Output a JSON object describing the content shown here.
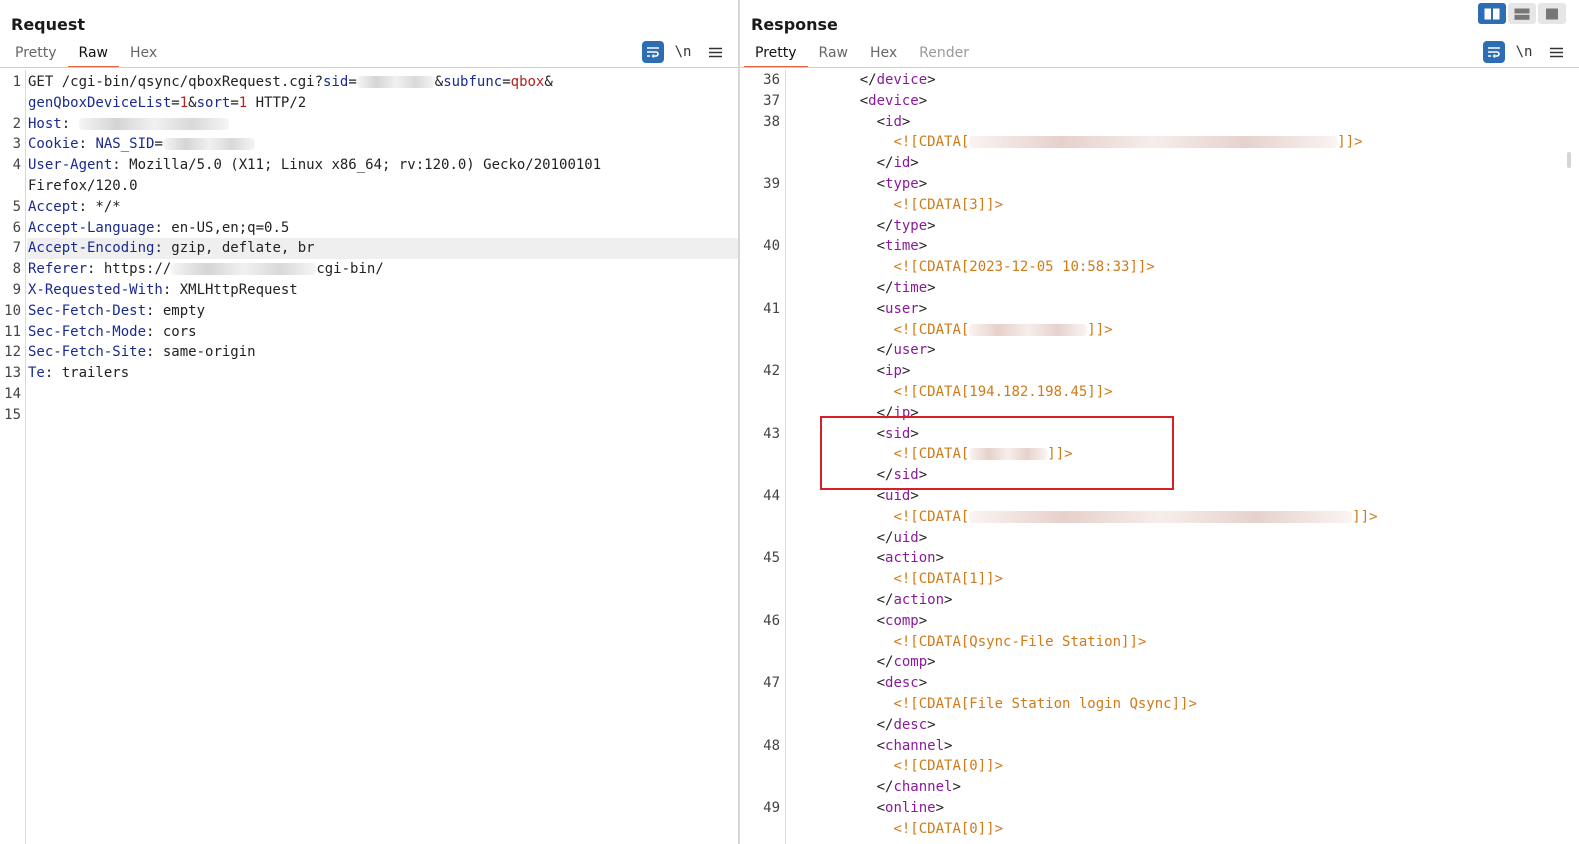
{
  "request": {
    "title": "Request",
    "tabs": [
      {
        "label": "Pretty"
      },
      {
        "label": "Raw"
      },
      {
        "label": "Hex"
      }
    ],
    "active_tab": "Raw",
    "tools": {
      "wrap_icon": "wrap-lines-icon",
      "newline_label": "\\n",
      "menu_icon": "menu-icon"
    },
    "lines": [
      {
        "n": "1",
        "segs": [
          [
            "t",
            "GET /cgi-bin/qsync/qboxRequest.cgi?"
          ],
          [
            "k",
            "sid"
          ],
          [
            "t",
            "="
          ],
          [
            "b",
            ""
          ],
          [
            "t",
            "&"
          ],
          [
            "k",
            "subfunc"
          ],
          [
            "t",
            "="
          ],
          [
            "v",
            "qbox"
          ],
          [
            "t",
            "&"
          ]
        ]
      },
      {
        "n": "",
        "segs": [
          [
            "k",
            "genQboxDeviceList"
          ],
          [
            "t",
            "="
          ],
          [
            "v",
            "1"
          ],
          [
            "t",
            "&"
          ],
          [
            "k",
            "sort"
          ],
          [
            "t",
            "="
          ],
          [
            "v",
            "1"
          ],
          [
            "t",
            " HTTP/2"
          ]
        ]
      },
      {
        "n": "2",
        "segs": [
          [
            "k",
            "Host"
          ],
          [
            "t",
            ": "
          ],
          [
            "b",
            ""
          ]
        ]
      },
      {
        "n": "3",
        "segs": [
          [
            "k",
            "Cookie"
          ],
          [
            "t",
            ": "
          ],
          [
            "k",
            "NAS_SID"
          ],
          [
            "t",
            "="
          ],
          [
            "b",
            ""
          ]
        ]
      },
      {
        "n": "4",
        "segs": [
          [
            "k",
            "User-Agent"
          ],
          [
            "t",
            ": Mozilla/5.0 (X11; Linux x86_64; rv:120.0) Gecko/20100101"
          ]
        ]
      },
      {
        "n": "",
        "segs": [
          [
            "t",
            "Firefox/120.0"
          ]
        ]
      },
      {
        "n": "5",
        "segs": [
          [
            "k",
            "Accept"
          ],
          [
            "t",
            ": */*"
          ]
        ]
      },
      {
        "n": "6",
        "segs": [
          [
            "k",
            "Accept-Language"
          ],
          [
            "t",
            ": en-US,en;q=0.5"
          ]
        ]
      },
      {
        "n": "7",
        "hl": true,
        "segs": [
          [
            "k",
            "Accept-Encoding"
          ],
          [
            "t",
            ": gzip, deflate, br"
          ]
        ]
      },
      {
        "n": "8",
        "segs": [
          [
            "k",
            "Referer"
          ],
          [
            "t",
            ": https://"
          ],
          [
            "b",
            ""
          ],
          [
            "t",
            "cgi-bin/"
          ]
        ]
      },
      {
        "n": "9",
        "segs": [
          [
            "k",
            "X-Requested-With"
          ],
          [
            "t",
            ": XMLHttpRequest"
          ]
        ]
      },
      {
        "n": "10",
        "segs": [
          [
            "k",
            "Sec-Fetch-Dest"
          ],
          [
            "t",
            ": empty"
          ]
        ]
      },
      {
        "n": "11",
        "segs": [
          [
            "k",
            "Sec-Fetch-Mode"
          ],
          [
            "t",
            ": cors"
          ]
        ]
      },
      {
        "n": "12",
        "segs": [
          [
            "k",
            "Sec-Fetch-Site"
          ],
          [
            "t",
            ": same-origin"
          ]
        ]
      },
      {
        "n": "13",
        "segs": [
          [
            "k",
            "Te"
          ],
          [
            "t",
            ": trailers"
          ]
        ]
      },
      {
        "n": "14",
        "segs": []
      },
      {
        "n": "15",
        "segs": []
      }
    ]
  },
  "response": {
    "title": "Response",
    "tabs": [
      {
        "label": "Pretty"
      },
      {
        "label": "Raw"
      },
      {
        "label": "Hex"
      },
      {
        "label": "Render"
      }
    ],
    "active_tab": "Pretty",
    "tools": {
      "wrap_icon": "wrap-lines-icon",
      "newline_label": "\\n",
      "menu_icon": "menu-icon"
    },
    "lines": [
      {
        "n": "36",
        "i": 4,
        "segs": [
          [
            "t",
            "</"
          ],
          [
            "g",
            "device"
          ],
          [
            "t",
            ">"
          ]
        ]
      },
      {
        "n": "37",
        "i": 4,
        "segs": [
          [
            "t",
            "<"
          ],
          [
            "g",
            "device"
          ],
          [
            "t",
            ">"
          ]
        ]
      },
      {
        "n": "38",
        "i": 6,
        "segs": [
          [
            "t",
            "<"
          ],
          [
            "g",
            "id"
          ],
          [
            "t",
            ">"
          ]
        ]
      },
      {
        "n": "",
        "i": 8,
        "segs": [
          [
            "c",
            "<![CDATA["
          ],
          [
            "b",
            ""
          ],
          [
            "c",
            "]]>"
          ]
        ]
      },
      {
        "n": "",
        "i": 6,
        "segs": [
          [
            "t",
            "</"
          ],
          [
            "g",
            "id"
          ],
          [
            "t",
            ">"
          ]
        ]
      },
      {
        "n": "39",
        "i": 6,
        "segs": [
          [
            "t",
            "<"
          ],
          [
            "g",
            "type"
          ],
          [
            "t",
            ">"
          ]
        ]
      },
      {
        "n": "",
        "i": 8,
        "segs": [
          [
            "c",
            "<![CDATA[3]]>"
          ]
        ]
      },
      {
        "n": "",
        "i": 6,
        "segs": [
          [
            "t",
            "</"
          ],
          [
            "g",
            "type"
          ],
          [
            "t",
            ">"
          ]
        ]
      },
      {
        "n": "40",
        "i": 6,
        "segs": [
          [
            "t",
            "<"
          ],
          [
            "g",
            "time"
          ],
          [
            "t",
            ">"
          ]
        ]
      },
      {
        "n": "",
        "i": 8,
        "segs": [
          [
            "c",
            "<![CDATA[2023-12-05 10:58:33]]>"
          ]
        ]
      },
      {
        "n": "",
        "i": 6,
        "segs": [
          [
            "t",
            "</"
          ],
          [
            "g",
            "time"
          ],
          [
            "t",
            ">"
          ]
        ]
      },
      {
        "n": "41",
        "i": 6,
        "segs": [
          [
            "t",
            "<"
          ],
          [
            "g",
            "user"
          ],
          [
            "t",
            ">"
          ]
        ]
      },
      {
        "n": "",
        "i": 8,
        "segs": [
          [
            "c",
            "<![CDATA["
          ],
          [
            "b",
            ""
          ],
          [
            "c",
            "]]>"
          ]
        ]
      },
      {
        "n": "",
        "i": 6,
        "segs": [
          [
            "t",
            "</"
          ],
          [
            "g",
            "user"
          ],
          [
            "t",
            ">"
          ]
        ]
      },
      {
        "n": "42",
        "i": 6,
        "segs": [
          [
            "t",
            "<"
          ],
          [
            "g",
            "ip"
          ],
          [
            "t",
            ">"
          ]
        ]
      },
      {
        "n": "",
        "i": 8,
        "segs": [
          [
            "c",
            "<![CDATA[194.182.198.45]]>"
          ]
        ]
      },
      {
        "n": "",
        "i": 6,
        "segs": [
          [
            "t",
            "</"
          ],
          [
            "g",
            "ip"
          ],
          [
            "t",
            ">"
          ]
        ]
      },
      {
        "n": "43",
        "i": 6,
        "segs": [
          [
            "t",
            "<"
          ],
          [
            "g",
            "sid"
          ],
          [
            "t",
            ">"
          ]
        ]
      },
      {
        "n": "",
        "i": 8,
        "segs": [
          [
            "c",
            "<![CDATA["
          ],
          [
            "b",
            ""
          ],
          [
            "c",
            "]]>"
          ]
        ]
      },
      {
        "n": "",
        "i": 6,
        "segs": [
          [
            "t",
            "</"
          ],
          [
            "g",
            "sid"
          ],
          [
            "t",
            ">"
          ]
        ]
      },
      {
        "n": "44",
        "i": 6,
        "segs": [
          [
            "t",
            "<"
          ],
          [
            "g",
            "uid"
          ],
          [
            "t",
            ">"
          ]
        ]
      },
      {
        "n": "",
        "i": 8,
        "segs": [
          [
            "c",
            "<![CDATA["
          ],
          [
            "b",
            ""
          ],
          [
            "c",
            "]]>"
          ]
        ]
      },
      {
        "n": "",
        "i": 6,
        "segs": [
          [
            "t",
            "</"
          ],
          [
            "g",
            "uid"
          ],
          [
            "t",
            ">"
          ]
        ]
      },
      {
        "n": "45",
        "i": 6,
        "segs": [
          [
            "t",
            "<"
          ],
          [
            "g",
            "action"
          ],
          [
            "t",
            ">"
          ]
        ]
      },
      {
        "n": "",
        "i": 8,
        "segs": [
          [
            "c",
            "<![CDATA[1]]>"
          ]
        ]
      },
      {
        "n": "",
        "i": 6,
        "segs": [
          [
            "t",
            "</"
          ],
          [
            "g",
            "action"
          ],
          [
            "t",
            ">"
          ]
        ]
      },
      {
        "n": "46",
        "i": 6,
        "segs": [
          [
            "t",
            "<"
          ],
          [
            "g",
            "comp"
          ],
          [
            "t",
            ">"
          ]
        ]
      },
      {
        "n": "",
        "i": 8,
        "segs": [
          [
            "c",
            "<![CDATA[Qsync-File Station]]>"
          ]
        ]
      },
      {
        "n": "",
        "i": 6,
        "segs": [
          [
            "t",
            "</"
          ],
          [
            "g",
            "comp"
          ],
          [
            "t",
            ">"
          ]
        ]
      },
      {
        "n": "47",
        "i": 6,
        "segs": [
          [
            "t",
            "<"
          ],
          [
            "g",
            "desc"
          ],
          [
            "t",
            ">"
          ]
        ]
      },
      {
        "n": "",
        "i": 8,
        "segs": [
          [
            "c",
            "<![CDATA[File Station login Qsync]]>"
          ]
        ]
      },
      {
        "n": "",
        "i": 6,
        "segs": [
          [
            "t",
            "</"
          ],
          [
            "g",
            "desc"
          ],
          [
            "t",
            ">"
          ]
        ]
      },
      {
        "n": "48",
        "i": 6,
        "segs": [
          [
            "t",
            "<"
          ],
          [
            "g",
            "channel"
          ],
          [
            "t",
            ">"
          ]
        ]
      },
      {
        "n": "",
        "i": 8,
        "segs": [
          [
            "c",
            "<![CDATA[0]]>"
          ]
        ]
      },
      {
        "n": "",
        "i": 6,
        "segs": [
          [
            "t",
            "</"
          ],
          [
            "g",
            "channel"
          ],
          [
            "t",
            ">"
          ]
        ]
      },
      {
        "n": "49",
        "i": 6,
        "segs": [
          [
            "t",
            "<"
          ],
          [
            "g",
            "online"
          ],
          [
            "t",
            ">"
          ]
        ]
      },
      {
        "n": "",
        "i": 8,
        "segs": [
          [
            "c",
            "<![CDATA[0]]>"
          ]
        ]
      }
    ]
  },
  "layout_buttons": [
    {
      "name": "side-by-side-layout-icon"
    },
    {
      "name": "top-bottom-layout-icon"
    },
    {
      "name": "single-pane-layout-icon"
    }
  ],
  "colors": {
    "accent": "#e8643c",
    "tool_active": "#2d6db3",
    "highlight_box": "#d61f26",
    "tag": "#8a1a9b",
    "cdata": "#d07a18",
    "header_name": "#1a2a8f",
    "param_value": "#b32020"
  }
}
